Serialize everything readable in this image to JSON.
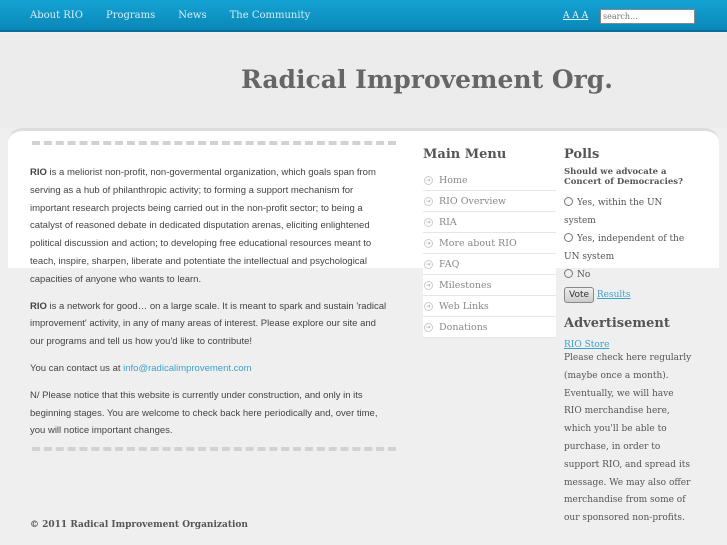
{
  "nav": [
    "About RIO",
    "Programs",
    "News",
    "The Community"
  ],
  "font_sizes": "A A A",
  "search": {
    "placeholder": "search..."
  },
  "site_title": "Radical Improvement Org.",
  "main": {
    "p1_bold": "RIO",
    "p1": " is a meliorist non-profit, non-govermental organization, which goals span from serving as a hub of philanthropic activity; to forming a support mechanism for important research projects being carried out in the non-profit sector; to being a catalyst of reasoned debate in dedicated disputation arenas, eliciting enlightened political discussion and action; to developing free educational resources meant to teach, inspire, sharpen, liberate and potentiate the intellectual and psychological capacities of anyone who wants to learn.",
    "p2_bold": "RIO",
    "p2": " is a network for good… on a large scale. It is meant to spark and sustain 'radical improvement' activity, in any of many areas of interest. Please explore our site and our programs and tell us how you'd like to contribute!",
    "p3": "You can contact us at ",
    "email": "info@radicalimprovement.com",
    "p4": "N/ Please notice that this website is currently under construction, and only in its beginning stages. You are welcome to check back here periodically and, over time, you will notice important changes."
  },
  "menu": {
    "title": "Main Menu",
    "items": [
      "Home",
      "RIO Overview",
      "RIA",
      "More about RIO",
      "FAQ",
      "Milestones",
      "Web Links",
      "Donations"
    ]
  },
  "polls": {
    "title": "Polls",
    "question": "Should we advocate a Concert of Democracies?",
    "options": [
      "Yes, within the UN system",
      "Yes, independent of the UN system",
      "No"
    ],
    "vote": "Vote",
    "results": "Results"
  },
  "ad": {
    "title": "Advertisement",
    "link": "RIO Store",
    "text": "Please check here regularly (maybe once a month). Eventually, we will have RIO merchandise here, which you'll be able to purchase, in order to support RIO, and spread its message. We may also offer merchandise from some of our sponsored non-profits."
  },
  "footer": "© 2011 Radical Improvement Organization"
}
